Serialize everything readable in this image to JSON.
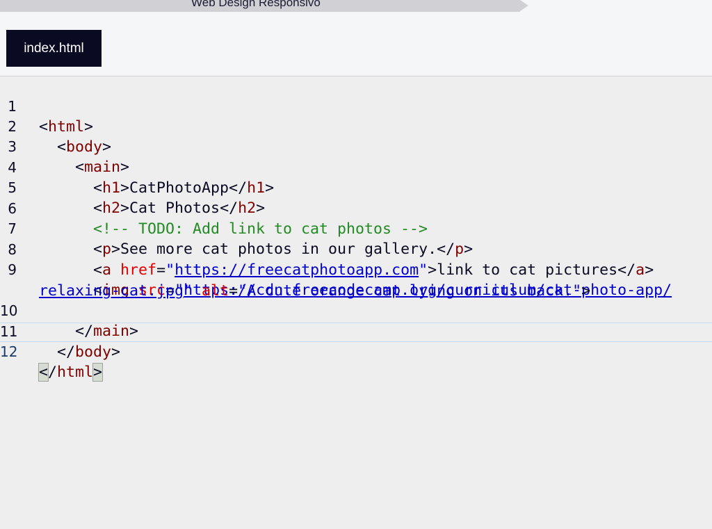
{
  "breadcrumb": {
    "label": "Web Design Responsivo"
  },
  "file_tab": {
    "label": "index.html"
  },
  "editor": {
    "line_numbers": [
      "1",
      "2",
      "3",
      "4",
      "5",
      "6",
      "7",
      "8",
      "9",
      "10",
      "11",
      "12"
    ],
    "lines": {
      "l1_tag": "html",
      "l2_tag": "body",
      "l3_tag": "main",
      "l4_tag_open": "h1",
      "l4_text": "CatPhotoApp",
      "l4_tag_close": "h1",
      "l5_tag_open": "h2",
      "l5_text": "Cat Photos",
      "l5_tag_close": "h2",
      "l6_comment": "<!-- TODO: Add link to cat photos -->",
      "l7_tag_open": "p",
      "l7_text": "See more cat photos in our gallery.",
      "l7_tag_close": "p",
      "l8_tag_open": "a",
      "l8_attr": "href",
      "l8_url": "https://freecatphotoapp.com",
      "l8_text": "link to cat pictures",
      "l8_tag_close": "a",
      "l9_tag": "img",
      "l9_attr_src": "src",
      "l9_url_part1": "https://cdn.freecodecamp.org/curriculum/cat-photo-app/",
      "l9_url_part2": "relaxing-cat.jpg",
      "l9_attr_alt": "alt",
      "l9_alt_value": "A cute orange cat lying on its back.",
      "l10_tag": "main",
      "l11_tag": "body",
      "l12_tag": "html"
    }
  }
}
